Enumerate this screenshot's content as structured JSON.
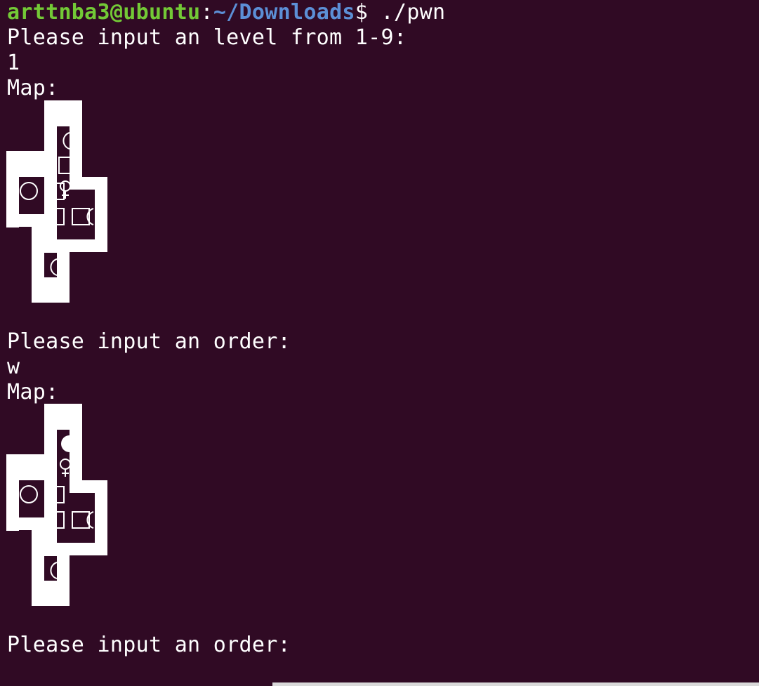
{
  "prompt": {
    "user": "arttnba3@ubuntu",
    "sep": ":",
    "path": "~/Downloads",
    "dollar": "$",
    "command": " ./pwn"
  },
  "lines": {
    "level_prompt": "Please input an level from 1-9:",
    "level_value": "1",
    "map_label_1": "Map:",
    "order_prompt_1": "Please input an order:",
    "order_value_1": "w",
    "map_label_2": "Map:",
    "order_prompt_2": "Please input an order:"
  },
  "colors": {
    "background": "#300a24",
    "user": "#73c936",
    "path": "#5c8fd6",
    "text": "#ffffff"
  },
  "icons": [
    "wall-block",
    "goal-circle",
    "box-square",
    "player-female-sign"
  ]
}
